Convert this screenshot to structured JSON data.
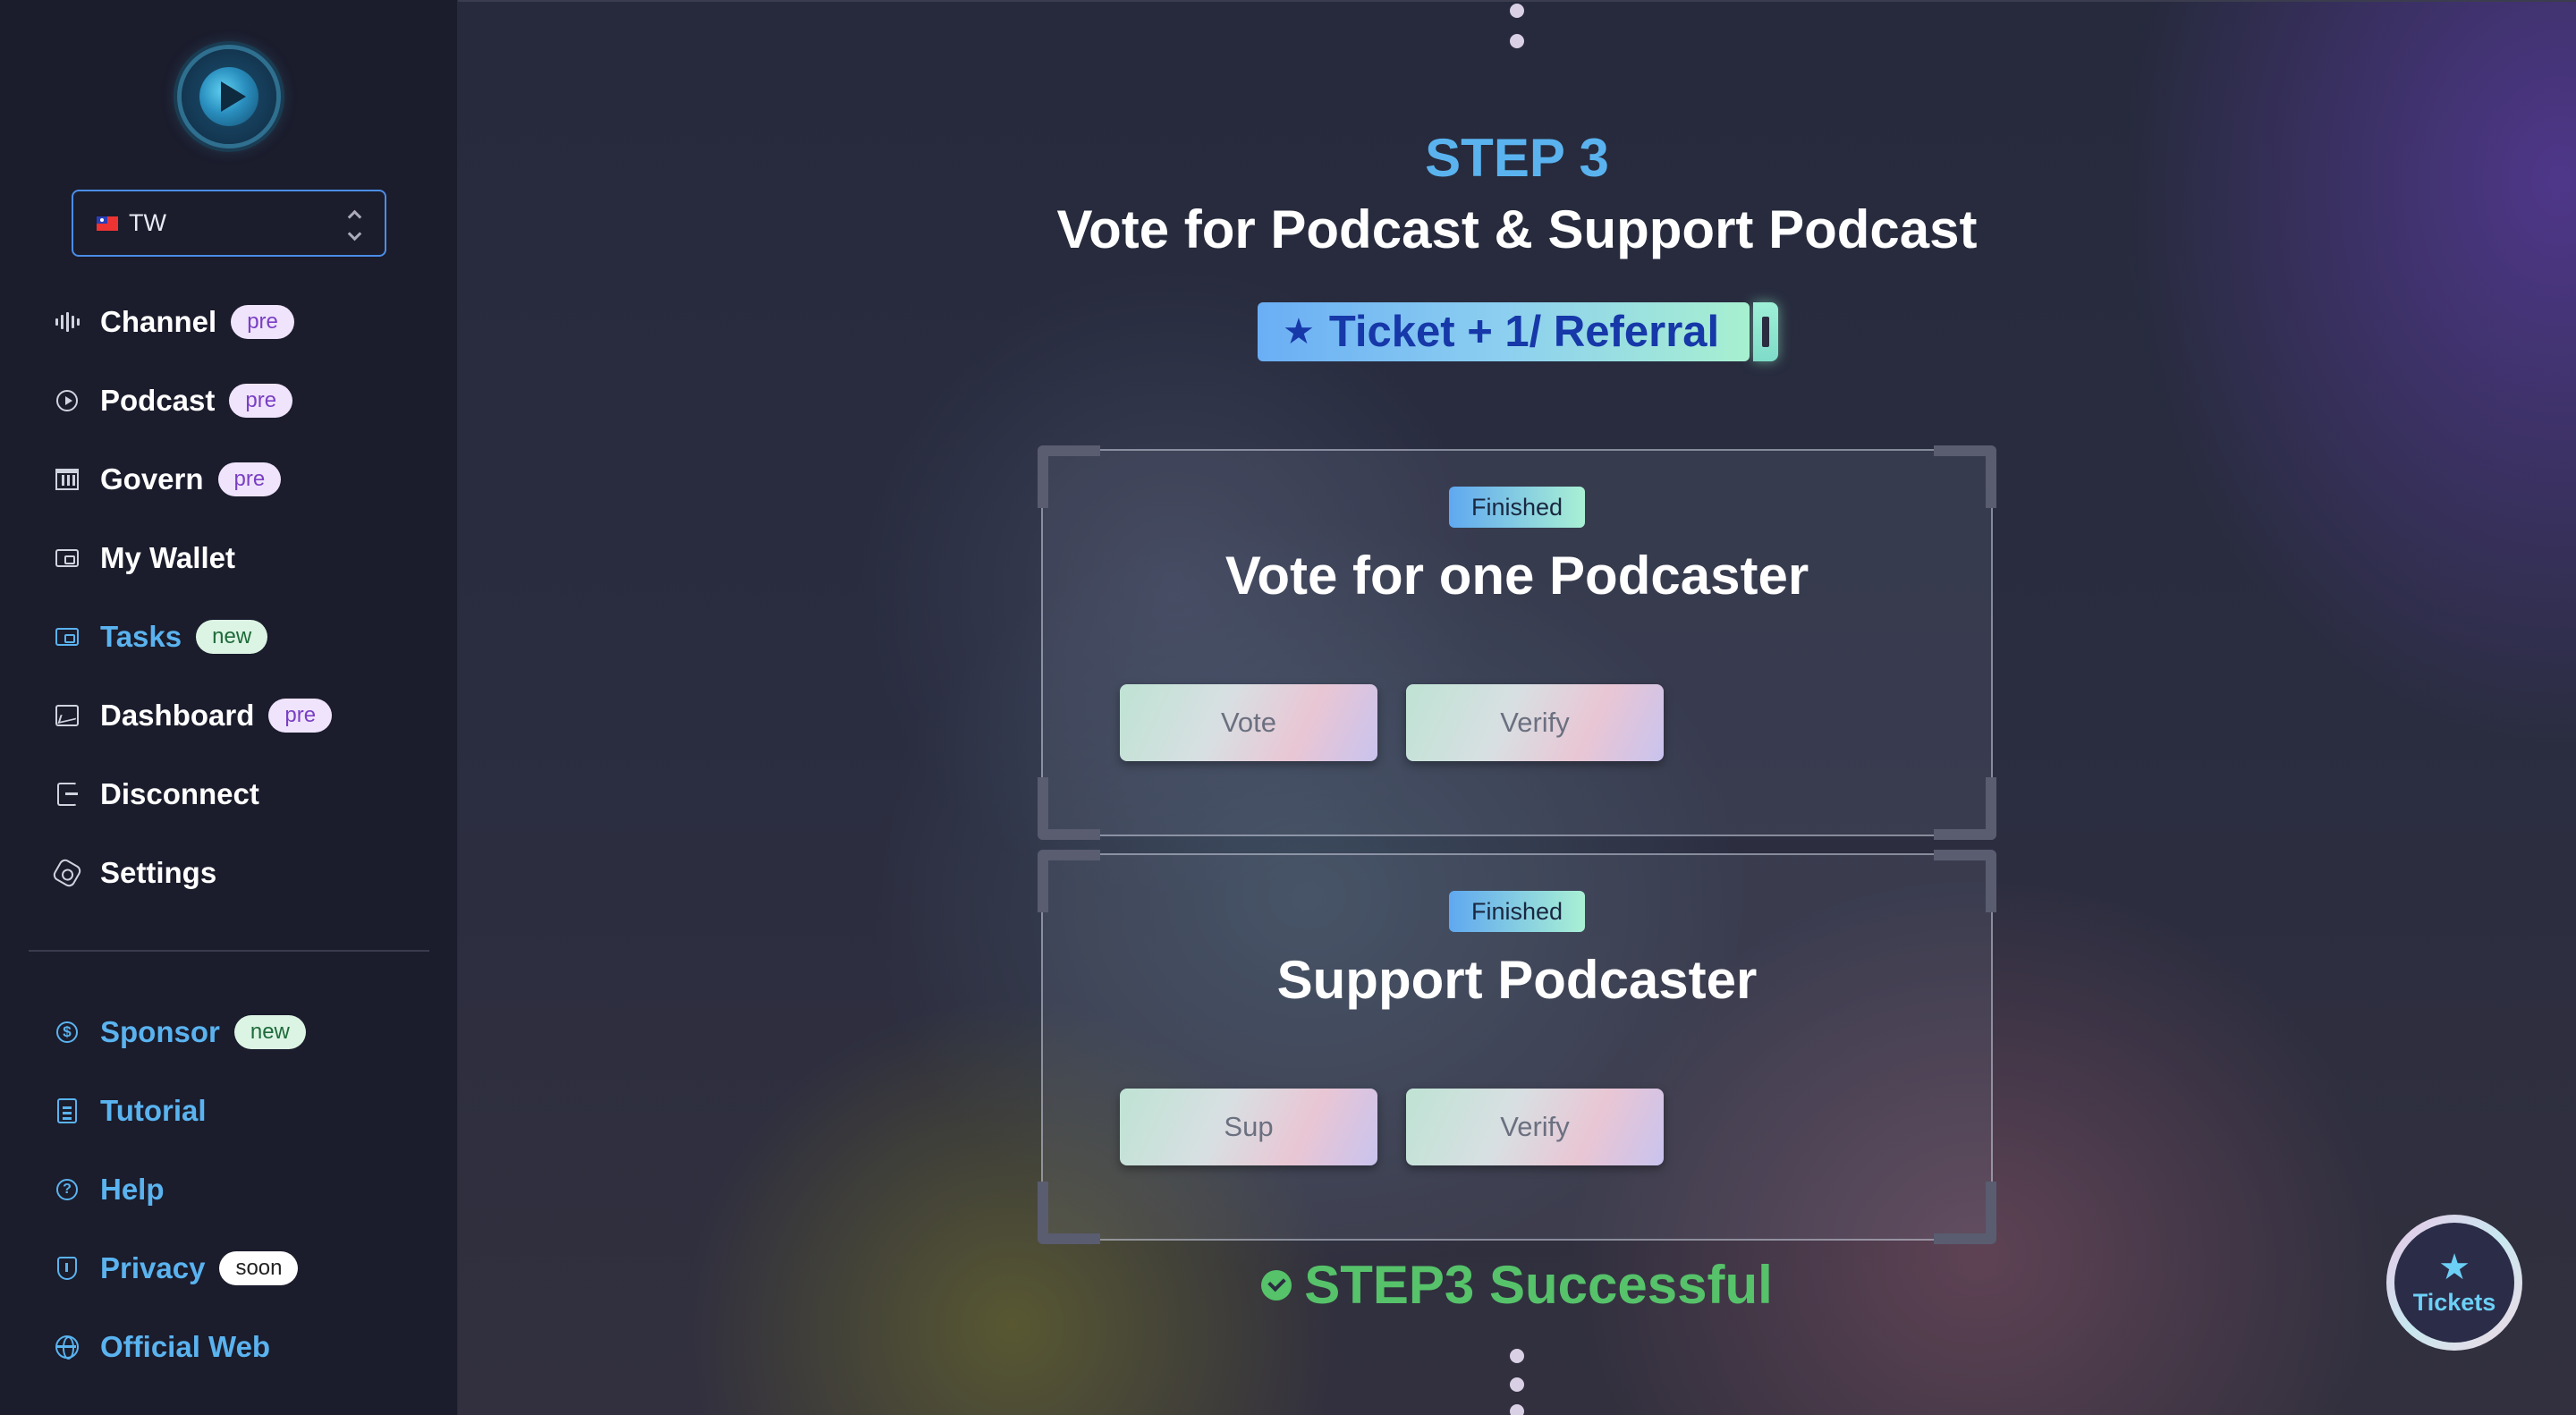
{
  "sidebar": {
    "region": {
      "flag": "taiwan-flag-icon",
      "value": "TW"
    },
    "nav": [
      {
        "label": "Channel",
        "icon": "audio-bars-icon",
        "badge": "pre"
      },
      {
        "label": "Podcast",
        "icon": "play-circle-icon",
        "badge": "pre"
      },
      {
        "label": "Govern",
        "icon": "bank-icon",
        "badge": "pre"
      },
      {
        "label": "My Wallet",
        "icon": "wallet-icon",
        "badge": ""
      },
      {
        "label": "Tasks",
        "icon": "wallet-icon",
        "badge": "new"
      },
      {
        "label": "Dashboard",
        "icon": "chart-icon",
        "badge": "pre"
      },
      {
        "label": "Disconnect",
        "icon": "exit-icon",
        "badge": ""
      },
      {
        "label": "Settings",
        "icon": "settings-icon",
        "badge": ""
      }
    ],
    "secondary": [
      {
        "label": "Sponsor",
        "icon": "dollar-icon",
        "badge": "new"
      },
      {
        "label": "Tutorial",
        "icon": "document-icon",
        "badge": ""
      },
      {
        "label": "Help",
        "icon": "help-icon",
        "badge": ""
      },
      {
        "label": "Privacy",
        "icon": "shield-icon",
        "badge": "soon"
      },
      {
        "label": "Official Web",
        "icon": "globe-icon",
        "badge": ""
      }
    ],
    "active_item": "Tasks"
  },
  "main": {
    "step_label": "STEP 3",
    "step_title": "Vote for Podcast & Support Podcast",
    "ticket_reward": "Ticket + 1/ Referral",
    "cards": [
      {
        "status": "Finished",
        "title": "Vote for one Podcaster",
        "buttons": [
          "Vote",
          "Verify"
        ]
      },
      {
        "status": "Finished",
        "title": "Support Podcaster",
        "buttons": [
          "Sup",
          "Verify"
        ]
      }
    ],
    "success_text": "STEP3 Successful"
  },
  "fab": {
    "label": "Tickets",
    "icon": "star-icon"
  },
  "colors": {
    "sidebar_bg": "#1b1c2c",
    "accent_blue": "#5ab3ef",
    "success_green": "#56c26a",
    "ticket_text": "#1638a8"
  }
}
